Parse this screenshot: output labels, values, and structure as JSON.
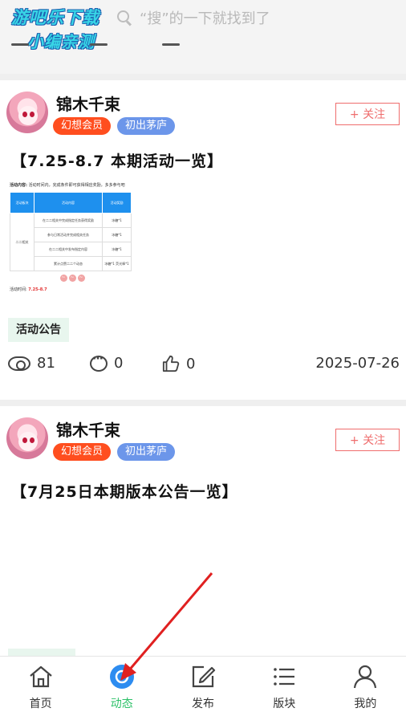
{
  "watermark": {
    "line1": "游吧乐下载",
    "line2": "小编亲测"
  },
  "search": {
    "placeholder": "“搜”的一下就找到了"
  },
  "posts": [
    {
      "username": "锦木千束",
      "badges": [
        "幻想会员",
        "初出茅庐"
      ],
      "follow_label": "+ 关注",
      "title": "【7.25-8.7 本期活动一览】",
      "image": {
        "intro_label": "活动内容:",
        "intro_text": "活动时间内，完成条件即可获得相应奖励，多多参与吧",
        "headers": [
          "活动板块",
          "活动内容",
          "活动奖励"
        ],
        "section": "二二相关",
        "rows": [
          [
            "在二二相关中完成指定任务获得奖励",
            "冰糖*1"
          ],
          [
            "参与日常活动并完成相关任务",
            "冰糖*1"
          ],
          [
            "在二二相关中发布指定内容",
            "冰糖*1"
          ],
          [
            "累计点赞二二个动态",
            "冰糖*1 荧光棒*1"
          ]
        ],
        "dots": [
          "~",
          "~",
          "~"
        ],
        "footer_label": "活动时间:",
        "footer_value": "7.25-8.7"
      },
      "tag": "活动公告",
      "views": "81",
      "comments": "0",
      "likes": "0",
      "date": "2025-07-26"
    },
    {
      "username": "锦木千束",
      "badges": [
        "幻想会员",
        "初出茅庐"
      ],
      "follow_label": "+ 关注",
      "title": "【7月25日本期版本公告一览】"
    }
  ],
  "nav": [
    {
      "label": "首页",
      "icon": "home-icon"
    },
    {
      "label": "动态",
      "icon": "moments-icon",
      "active": true
    },
    {
      "label": "发布",
      "icon": "edit-icon"
    },
    {
      "label": "版块",
      "icon": "list-icon"
    },
    {
      "label": "我的",
      "icon": "user-icon"
    }
  ],
  "colors": {
    "accent": "#2cc168",
    "follow": "#ef6d6d",
    "member_badge": "#ff4e1f",
    "level_badge": "#6c96ea",
    "annotation_arrow": "#e02020"
  }
}
